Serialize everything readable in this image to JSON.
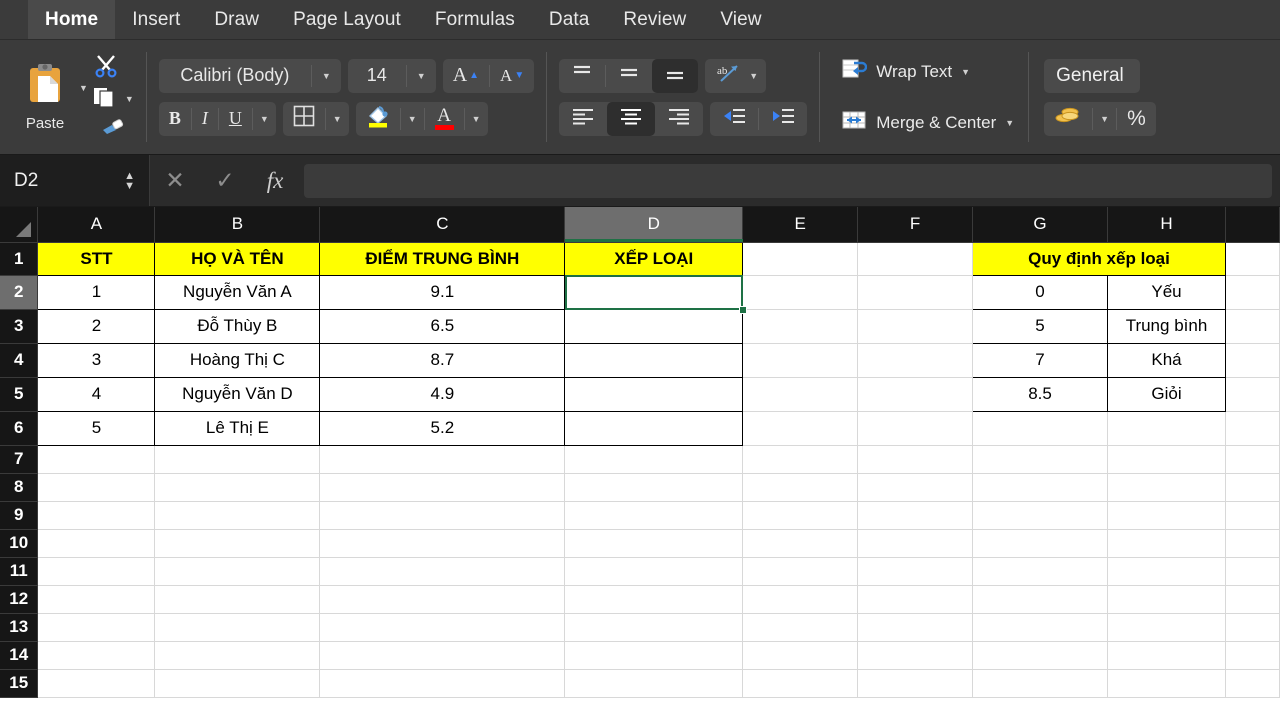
{
  "ribbon": {
    "tabs": [
      {
        "label": "Home",
        "active": true
      },
      {
        "label": "Insert",
        "active": false
      },
      {
        "label": "Draw",
        "active": false
      },
      {
        "label": "Page Layout",
        "active": false
      },
      {
        "label": "Formulas",
        "active": false
      },
      {
        "label": "Data",
        "active": false
      },
      {
        "label": "Review",
        "active": false
      },
      {
        "label": "View",
        "active": false
      }
    ],
    "clipboard": {
      "paste_label": "Paste",
      "paste_icon": "clipboard-icon",
      "cut_icon": "scissors-icon",
      "copy_icon": "copy-icon",
      "format_painter_icon": "paintbrush-icon"
    },
    "font": {
      "name": "Calibri (Body)",
      "size": "14",
      "bold_label": "B",
      "italic_label": "I",
      "underline_label": "U",
      "grow_font_label": "A",
      "shrink_font_label": "A",
      "borders_icon": "borders-icon",
      "fill_color_label": "fill-color-icon",
      "fill_color": "#ffff00",
      "font_color_label": "A",
      "font_color": "#ff0000"
    },
    "alignment": {
      "top_align_icon": "align-top-icon",
      "middle_align_icon": "align-middle-icon",
      "bottom_align_icon": "align-bottom-icon",
      "orientation_icon": "text-orientation-icon",
      "orientation_label": "ab",
      "align_left_icon": "align-left-icon",
      "align_center_icon": "align-center-icon",
      "align_right_icon": "align-right-icon",
      "decrease_indent_icon": "decrease-indent-icon",
      "increase_indent_icon": "increase-indent-icon",
      "wrap_text_label": "Wrap Text",
      "wrap_text_icon": "wrap-text-icon",
      "merge_center_label": "Merge & Center",
      "merge_center_icon": "merge-cells-icon"
    },
    "number": {
      "format_value": "General",
      "accounting_icon": "coins-icon",
      "percent_label": "%"
    }
  },
  "formula_bar": {
    "name_box": "D2",
    "cancel_icon": "close-icon",
    "confirm_icon": "check-icon",
    "function_icon": "fx",
    "formula_value": ""
  },
  "sheet": {
    "columns": [
      "A",
      "B",
      "C",
      "D",
      "E",
      "F",
      "G",
      "H"
    ],
    "selected_column": "D",
    "selected_row": "2",
    "selected_cell": "D2",
    "rows": [
      "1",
      "2",
      "3",
      "4",
      "5",
      "6",
      "7",
      "8",
      "9",
      "10",
      "11",
      "12",
      "13",
      "14",
      "15"
    ],
    "header_fill": "#ffff00",
    "selection_color": "#1e7145",
    "main_table": {
      "headers": [
        "STT",
        "HỌ VÀ TÊN",
        "ĐIỂM TRUNG BÌNH",
        "XẾP LOẠI"
      ],
      "rows": [
        {
          "stt": "1",
          "name": "Nguyễn Văn A",
          "score": "9.1",
          "grade": ""
        },
        {
          "stt": "2",
          "name": "Đỗ Thùy B",
          "score": "6.5",
          "grade": ""
        },
        {
          "stt": "3",
          "name": "Hoàng Thị C",
          "score": "8.7",
          "grade": ""
        },
        {
          "stt": "4",
          "name": "Nguyễn Văn D",
          "score": "4.9",
          "grade": ""
        },
        {
          "stt": "5",
          "name": "Lê Thị E",
          "score": "5.2",
          "grade": ""
        }
      ]
    },
    "lookup_table": {
      "title": "Quy định xếp loại",
      "rows": [
        {
          "threshold": "0",
          "label": "Yếu"
        },
        {
          "threshold": "5",
          "label": "Trung bình"
        },
        {
          "threshold": "7",
          "label": "Khá"
        },
        {
          "threshold": "8.5",
          "label": "Giỏi"
        }
      ]
    }
  }
}
